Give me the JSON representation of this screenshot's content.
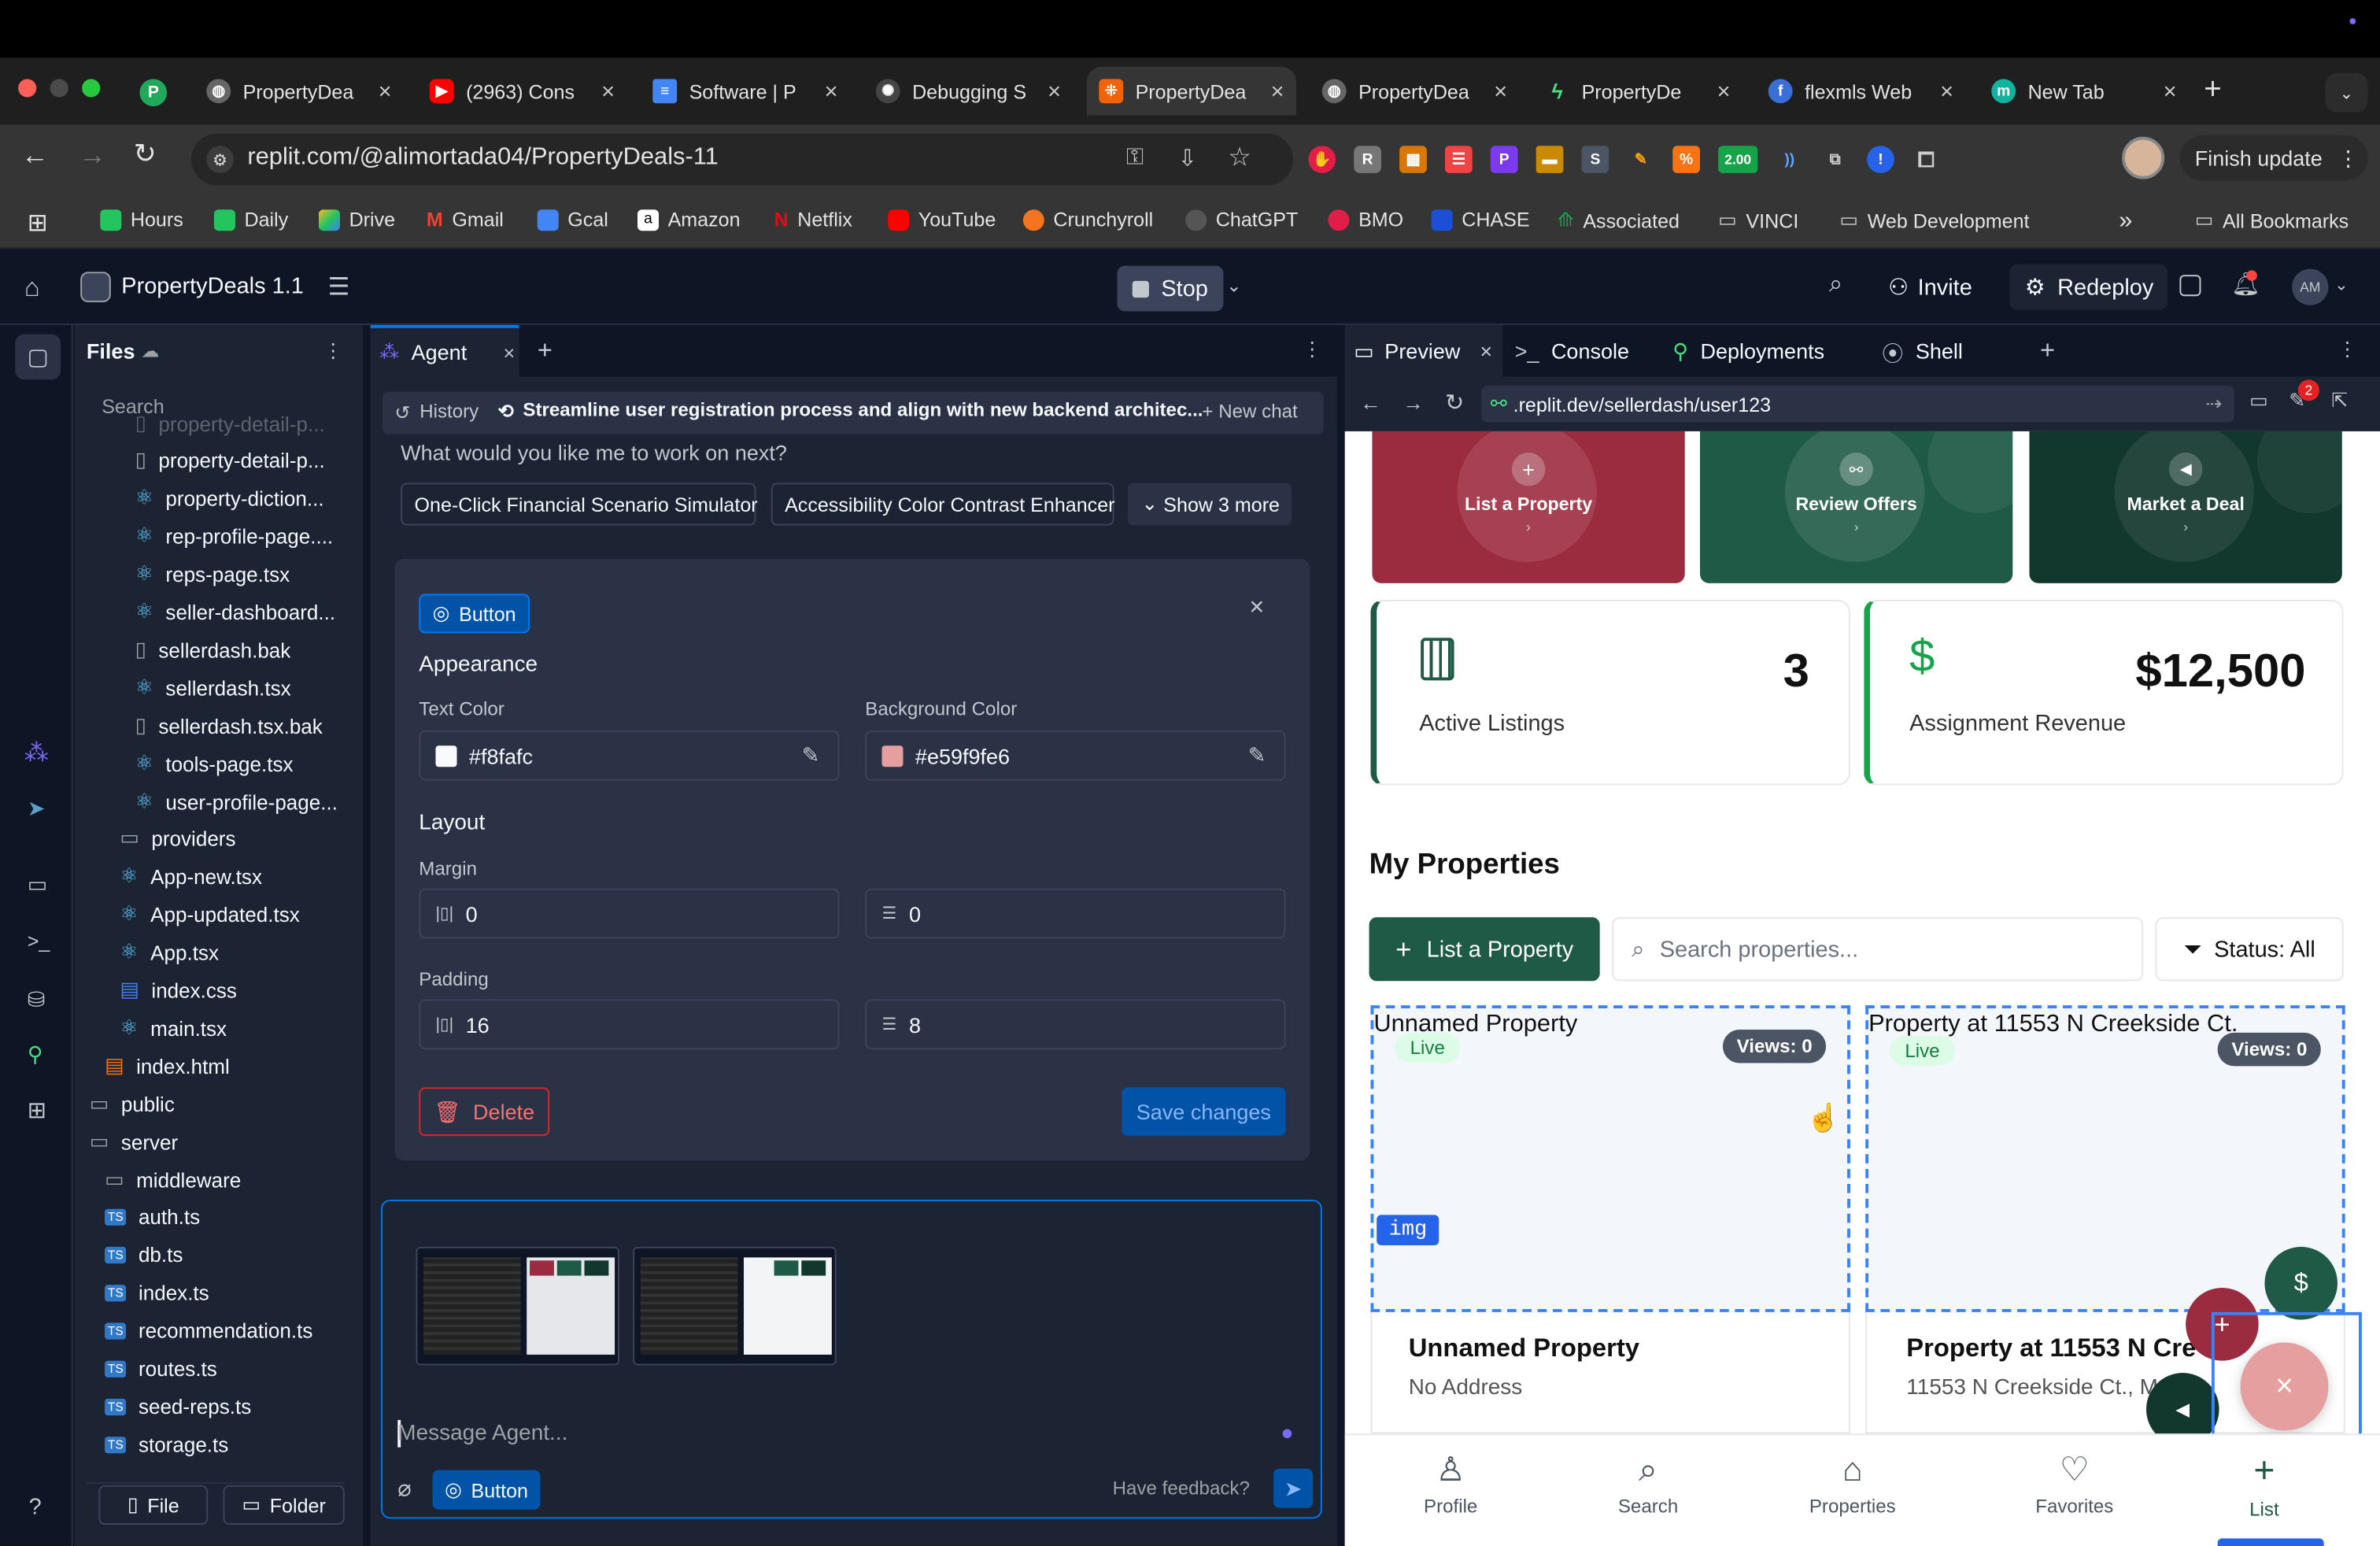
{
  "browser": {
    "tabs": [
      {
        "label": "PropertyDea",
        "icon": "P"
      },
      {
        "label": "PropertyDea",
        "icon": "globe"
      },
      {
        "label": "(2963) Cons",
        "icon": "youtube"
      },
      {
        "label": "Software | P",
        "icon": "docs"
      },
      {
        "label": "Debugging S",
        "icon": "openai"
      },
      {
        "label": "PropertyDea",
        "icon": "replit",
        "active": true
      },
      {
        "label": "PropertyDea",
        "icon": "globe"
      },
      {
        "label": "PropertyDe",
        "icon": "bolt"
      },
      {
        "label": "flexmls Web",
        "icon": "flexmls"
      },
      {
        "label": "New Tab",
        "icon": "m"
      }
    ],
    "url": "replit.com/@alimortada04/PropertyDeals-11",
    "finish_update": "Finish update",
    "ext_badge": "2.00",
    "bookmarks": [
      "Hours",
      "Daily",
      "Drive",
      "Gmail",
      "Gcal",
      "Amazon",
      "Netflix",
      "YouTube",
      "Crunchyroll",
      "ChatGPT",
      "BMO",
      "CHASE",
      "Associated",
      "VINCI",
      "Web Development"
    ],
    "all_bookmarks": "All Bookmarks"
  },
  "replit": {
    "project": "PropertyDeals 1.1",
    "stop": "Stop",
    "invite": "Invite",
    "redeploy": "Redeploy",
    "avatar": "AM"
  },
  "files": {
    "title": "Files",
    "search": "Search",
    "items": [
      "property-detail-p...",
      "property-detail-p...",
      "property-diction...",
      "rep-profile-page....",
      "reps-page.tsx",
      "seller-dashboard...",
      "sellerdash.bak",
      "sellerdash.tsx",
      "sellerdash.tsx.bak",
      "tools-page.tsx",
      "user-profile-page...",
      "providers",
      "App-new.tsx",
      "App-updated.tsx",
      "App.tsx",
      "index.css",
      "main.tsx",
      "index.html",
      "public",
      "server",
      "middleware",
      "auth.ts",
      "db.ts",
      "index.ts",
      "recommendation.ts",
      "routes.ts",
      "seed-reps.ts",
      "storage.ts"
    ],
    "file_btn": "File",
    "folder_btn": "Folder"
  },
  "agent": {
    "tab": "Agent",
    "history": "History",
    "thread": "Streamline user registration process and align with new backend architec...",
    "new_chat": "New chat",
    "prompt": "What would you like me to work on next?",
    "suggestions": [
      "One-Click Financial Scenario Simulator",
      "Accessibility Color Contrast Enhancer",
      "Show 3 more"
    ],
    "editor": {
      "badge": "Button",
      "appearance": "Appearance",
      "text_color_label": "Text Color",
      "text_color": "#f8fafc",
      "bg_color_label": "Background Color",
      "bg_color": "#e59f9fe6",
      "layout": "Layout",
      "margin": "Margin",
      "margin_x": "0",
      "margin_y": "0",
      "padding": "Padding",
      "padding_x": "16",
      "padding_y": "8",
      "delete": "Delete",
      "save": "Save changes"
    },
    "message_placeholder": "Message Agent...",
    "context_chip": "Button",
    "feedback": "Have feedback?"
  },
  "preview": {
    "tabs": [
      "Preview",
      "Console",
      "Deployments",
      "Shell"
    ],
    "url": ".replit.dev/sellerdash/user123",
    "badge_count": "2",
    "actions": [
      "List a Property",
      "Review Offers",
      "Market a Deal"
    ],
    "stats": [
      {
        "value": "3",
        "label": "Active Listings"
      },
      {
        "value": "$12,500",
        "label": "Assignment Revenue"
      }
    ],
    "section_title": "My Properties",
    "list_btn": "List a Property",
    "search_placeholder": "Search properties...",
    "status_filter": "Status: All",
    "listings": [
      {
        "alt": "Unnamed Property",
        "status": "Live",
        "views": "Views: 0",
        "title": "Unnamed Property",
        "address": "No Address"
      },
      {
        "alt": "Property at 11553 N Creekside Ct.",
        "status": "Live",
        "views": "Views: 0",
        "title": "Property at 11553 N Cre",
        "address": "11553 N Creekside Ct., M"
      }
    ],
    "img_tag": "img",
    "bottom_nav": [
      "Profile",
      "Search",
      "Properties",
      "Favorites",
      "List"
    ],
    "colors": {
      "burgundy": "#9b2c3f",
      "green": "#1e5a45",
      "dark_green": "#12372d",
      "accent": "#16a34a"
    }
  }
}
